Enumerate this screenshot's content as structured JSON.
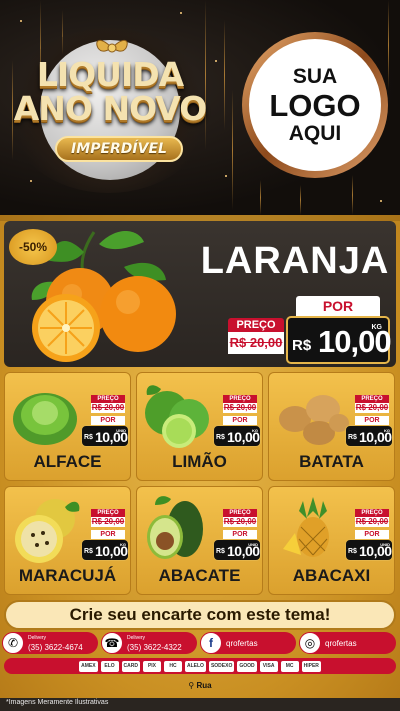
{
  "colors": {
    "red": "#c8102e",
    "gold": "#e5b54a",
    "dark": "#2a2521",
    "background_gold": "#d9a032"
  },
  "header": {
    "campaign_line1": "LIQUIDA",
    "campaign_line2": "ANO NOVO",
    "campaign_tag": "IMPERDÍVEL",
    "logo_line1": "SUA",
    "logo_line2": "LOGO",
    "logo_line3": "AQUI"
  },
  "hero": {
    "discount_badge": "-50%",
    "product": "LARANJA",
    "preco_label": "PREÇO",
    "old_price": "R$ 20,00",
    "por_label": "POR",
    "currency": "R$",
    "price": "10,00",
    "unit": "KG",
    "image": "orange-image"
  },
  "products": [
    {
      "name": "ALFACE",
      "preco_label": "PREÇO",
      "old_price": "R$ 20,00",
      "por_label": "POR",
      "currency": "R$",
      "price": "10,00",
      "unit": "UNID",
      "image": "lettuce-image"
    },
    {
      "name": "LIMÃO",
      "preco_label": "PREÇO",
      "old_price": "R$ 20,00",
      "por_label": "POR",
      "currency": "R$",
      "price": "10,00",
      "unit": "KG",
      "image": "lime-image"
    },
    {
      "name": "BATATA",
      "preco_label": "PREÇO",
      "old_price": "R$ 20,00",
      "por_label": "POR",
      "currency": "R$",
      "price": "10,00",
      "unit": "KG",
      "image": "potato-image"
    },
    {
      "name": "MARACUJÁ",
      "preco_label": "PREÇO",
      "old_price": "R$ 20,00",
      "por_label": "POR",
      "currency": "R$",
      "price": "10,00",
      "unit": "KG",
      "image": "passionfruit-image"
    },
    {
      "name": "ABACATE",
      "preco_label": "PREÇO",
      "old_price": "R$ 20,00",
      "por_label": "POR",
      "currency": "R$",
      "price": "10,00",
      "unit": "UNID",
      "image": "avocado-image"
    },
    {
      "name": "ABACAXI",
      "preco_label": "PREÇO",
      "old_price": "R$ 20,00",
      "por_label": "POR",
      "currency": "R$",
      "price": "10,00",
      "unit": "UNID",
      "image": "pineapple-image"
    }
  ],
  "cta": {
    "label": "Crie seu encarte com este tema!"
  },
  "contacts": [
    {
      "icon": "whatsapp-icon",
      "caption": "Delivery",
      "value": "(35) 3622-4674"
    },
    {
      "icon": "phone-icon",
      "caption": "Delivery",
      "value": "(35) 3622-4322"
    },
    {
      "icon": "facebook-icon",
      "caption": "",
      "value": "qrofertas"
    },
    {
      "icon": "instagram-icon",
      "caption": "",
      "value": "qrofertas"
    }
  ],
  "payments": [
    "AMEX",
    "ELO",
    "CARD",
    "PIX",
    "HC",
    "ALELO",
    "SODEXO",
    "GOOD",
    "VISA",
    "MC",
    "HIPER"
  ],
  "address": {
    "icon": "location-pin-icon",
    "label": "Rua"
  },
  "footer": {
    "disclaimer": "*Imagens Meramente Ilustrativas"
  }
}
